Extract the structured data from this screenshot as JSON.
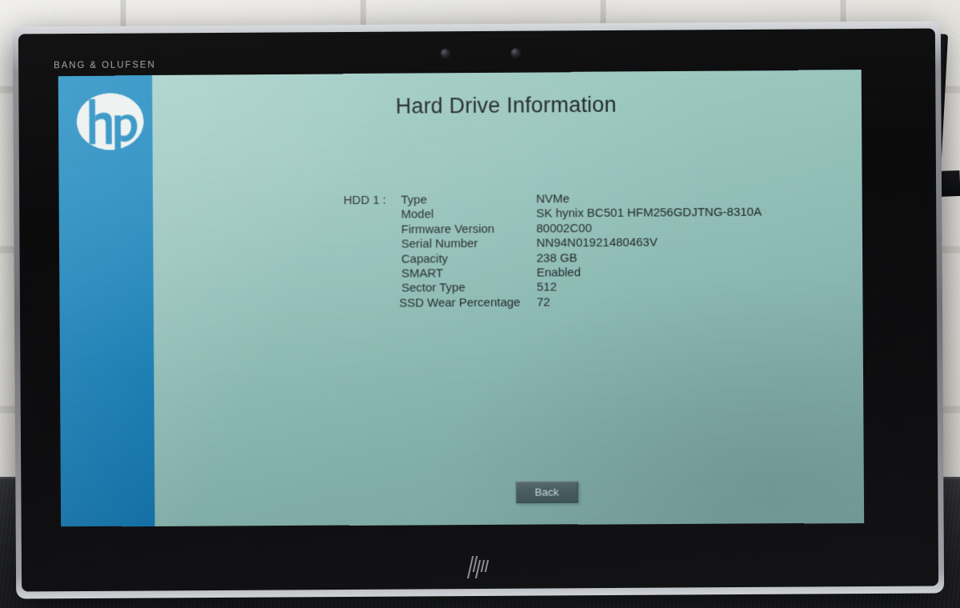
{
  "scene": {
    "description": "photo-of-tablet-on-desk",
    "wall_color": "#e9e7e2",
    "desk_color": "#232428"
  },
  "device": {
    "audio_brand": "BANG & OLUFSEN",
    "bottom_logo": "hp-logo-glyph",
    "camera_left": "camera-lens",
    "camera_right": "camera-lens",
    "bezel_color": "#0e0e10",
    "shell_color": "#8f9297"
  },
  "screen": {
    "background_color": "#8fbdb7",
    "accent_color": "#1179b2",
    "text_color": "#1d2427",
    "brand_logo": "hp-logo",
    "title": "Hard Drive Information",
    "hdd_label": "HDD 1 :",
    "rows": [
      {
        "label": "Type",
        "value": "NVMe"
      },
      {
        "label": "Model",
        "value": "SK hynix BC501 HFM256GDJTNG-8310A"
      },
      {
        "label": "Firmware Version",
        "value": "80002C00"
      },
      {
        "label": "Serial Number",
        "value": "NN94N01921480463V"
      },
      {
        "label": "Capacity",
        "value": "238 GB"
      },
      {
        "label": "SMART",
        "value": "Enabled"
      },
      {
        "label": "Sector Type",
        "value": "512"
      },
      {
        "label": "SSD Wear Percentage",
        "value": "72"
      }
    ],
    "back_button": "Back"
  }
}
